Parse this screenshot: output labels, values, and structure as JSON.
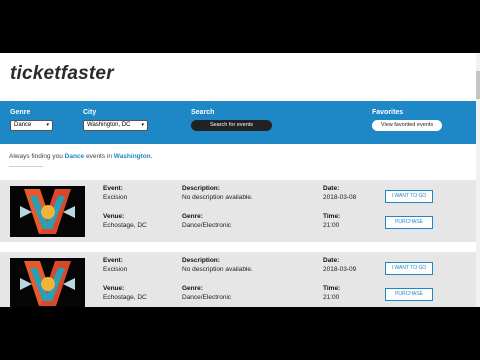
{
  "app": {
    "brand": "ticketfaster"
  },
  "filters": {
    "genre_label": "Genre",
    "genre_value": "Dance",
    "city_label": "City",
    "city_value": "Washington, DC",
    "search_label": "Search",
    "search_button": "Search for events",
    "favorites_label": "Favorites",
    "favorites_button": "View favorited events"
  },
  "tagline": {
    "pre": "Always finding you ",
    "genre": "Dance",
    "mid": " events in ",
    "city": "Washington",
    "post": "."
  },
  "field_labels": {
    "event": "Event:",
    "description": "Description:",
    "date": "Date:",
    "venue": "Venue:",
    "genre": "Genre:",
    "time": "Time:"
  },
  "events": [
    {
      "name": "Excision",
      "description": "No description available.",
      "date": "2018-03-08",
      "venue": "Echostage, DC",
      "genre": "Dance/Electronic",
      "time": "21:00",
      "want_label": "I WANT TO GO",
      "purchase_label": "PURCHASE"
    },
    {
      "name": "Excision",
      "description": "No description available.",
      "date": "2018-03-09",
      "venue": "Echostage, DC",
      "genre": "Dance/Electronic",
      "time": "21:00",
      "want_label": "I WANT TO GO",
      "purchase_label": "PURCHASE"
    }
  ],
  "colors": {
    "accent": "#1e88c7",
    "card_bg": "#e6e6e6",
    "letterbox": "#000000"
  },
  "icons": {
    "select_arrow": "chevron-updown-icon",
    "event_image": "excision-logo-image"
  }
}
